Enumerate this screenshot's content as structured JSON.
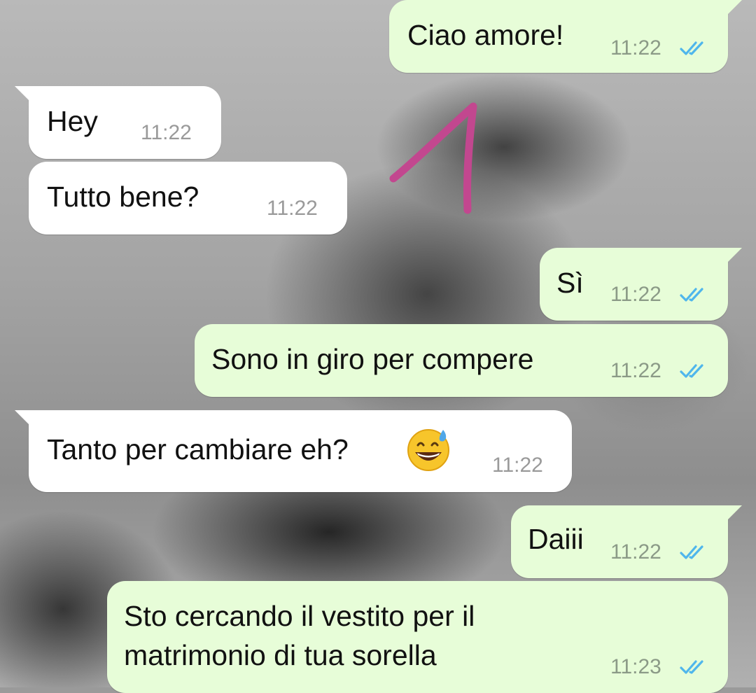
{
  "chat": {
    "messages": [
      {
        "text": "Ciao amore!",
        "time": "11:22",
        "direction": "outgoing",
        "status": "read"
      },
      {
        "text": "Hey",
        "time": "11:22",
        "direction": "incoming"
      },
      {
        "text": "Tutto bene?",
        "time": "11:22",
        "direction": "incoming"
      },
      {
        "text": "Sì",
        "time": "11:22",
        "direction": "outgoing",
        "status": "read"
      },
      {
        "text": "Sono in giro per compere",
        "time": "11:22",
        "direction": "outgoing",
        "status": "read"
      },
      {
        "text": "Tanto per cambiare eh?",
        "emoji": "grinning-face-with-sweat",
        "time": "11:22",
        "direction": "incoming"
      },
      {
        "text": "Daiii",
        "time": "11:22",
        "direction": "outgoing",
        "status": "read"
      },
      {
        "text_lines": [
          "Sto cercando il vestito per il",
          "matrimonio di tua sorella"
        ],
        "time": "11:23",
        "direction": "outgoing",
        "status": "read"
      }
    ]
  },
  "annotation": {
    "type": "hand-drawn-arrow",
    "color": "#c2478f"
  },
  "colors": {
    "outgoing_bubble": "#e7fdd8",
    "incoming_bubble": "#ffffff",
    "read_ticks": "#4fb6ec",
    "text": "#111111"
  }
}
